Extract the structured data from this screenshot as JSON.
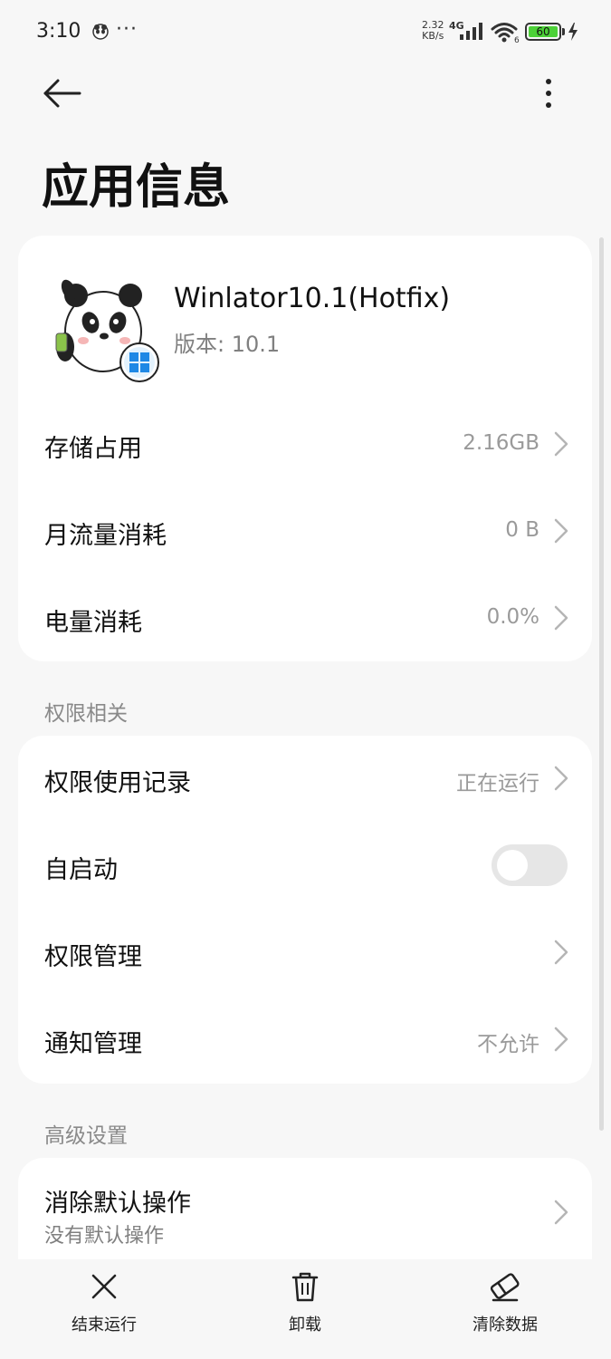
{
  "status_bar": {
    "time": "3:10",
    "more": "···",
    "speed_value": "2.32",
    "speed_unit": "KB/s",
    "network": "4G",
    "wifi_badge": "6",
    "battery_level": "60",
    "icons": [
      "notification-panda-icon",
      "signal-icon",
      "wifi-icon",
      "battery-icon",
      "charging-icon"
    ]
  },
  "header": {
    "title": "应用信息",
    "back_icon": "arrow-left-icon",
    "menu_icon": "more-vertical-icon"
  },
  "app": {
    "name": "Winlator10.1(Hotfix)",
    "version": "版本: 10.1"
  },
  "usage": [
    {
      "label": "存储占用",
      "value": "2.16GB"
    },
    {
      "label": "月流量消耗",
      "value": "0 B"
    },
    {
      "label": "电量消耗",
      "value": "0.0%"
    }
  ],
  "permissions_section": {
    "header": "权限相关",
    "items": [
      {
        "label": "权限使用记录",
        "value": "正在运行"
      },
      {
        "label": "自启动",
        "toggle_on": false
      },
      {
        "label": "权限管理",
        "value": ""
      },
      {
        "label": "通知管理",
        "value": "不允许"
      }
    ]
  },
  "advanced_section": {
    "header": "高级设置",
    "items": [
      {
        "label": "消除默认操作",
        "sub": "没有默认操作"
      }
    ]
  },
  "bottom_bar": {
    "actions": [
      {
        "label": "结束运行",
        "icon": "close-x-icon"
      },
      {
        "label": "卸载",
        "icon": "trash-icon"
      },
      {
        "label": "清除数据",
        "icon": "eraser-icon"
      }
    ]
  },
  "colors": {
    "background": "#f7f7f7",
    "card": "#ffffff",
    "secondary_text": "#9a9a9a",
    "toggle_off": "#e6e6e6",
    "battery_fill": "#4cd137"
  }
}
